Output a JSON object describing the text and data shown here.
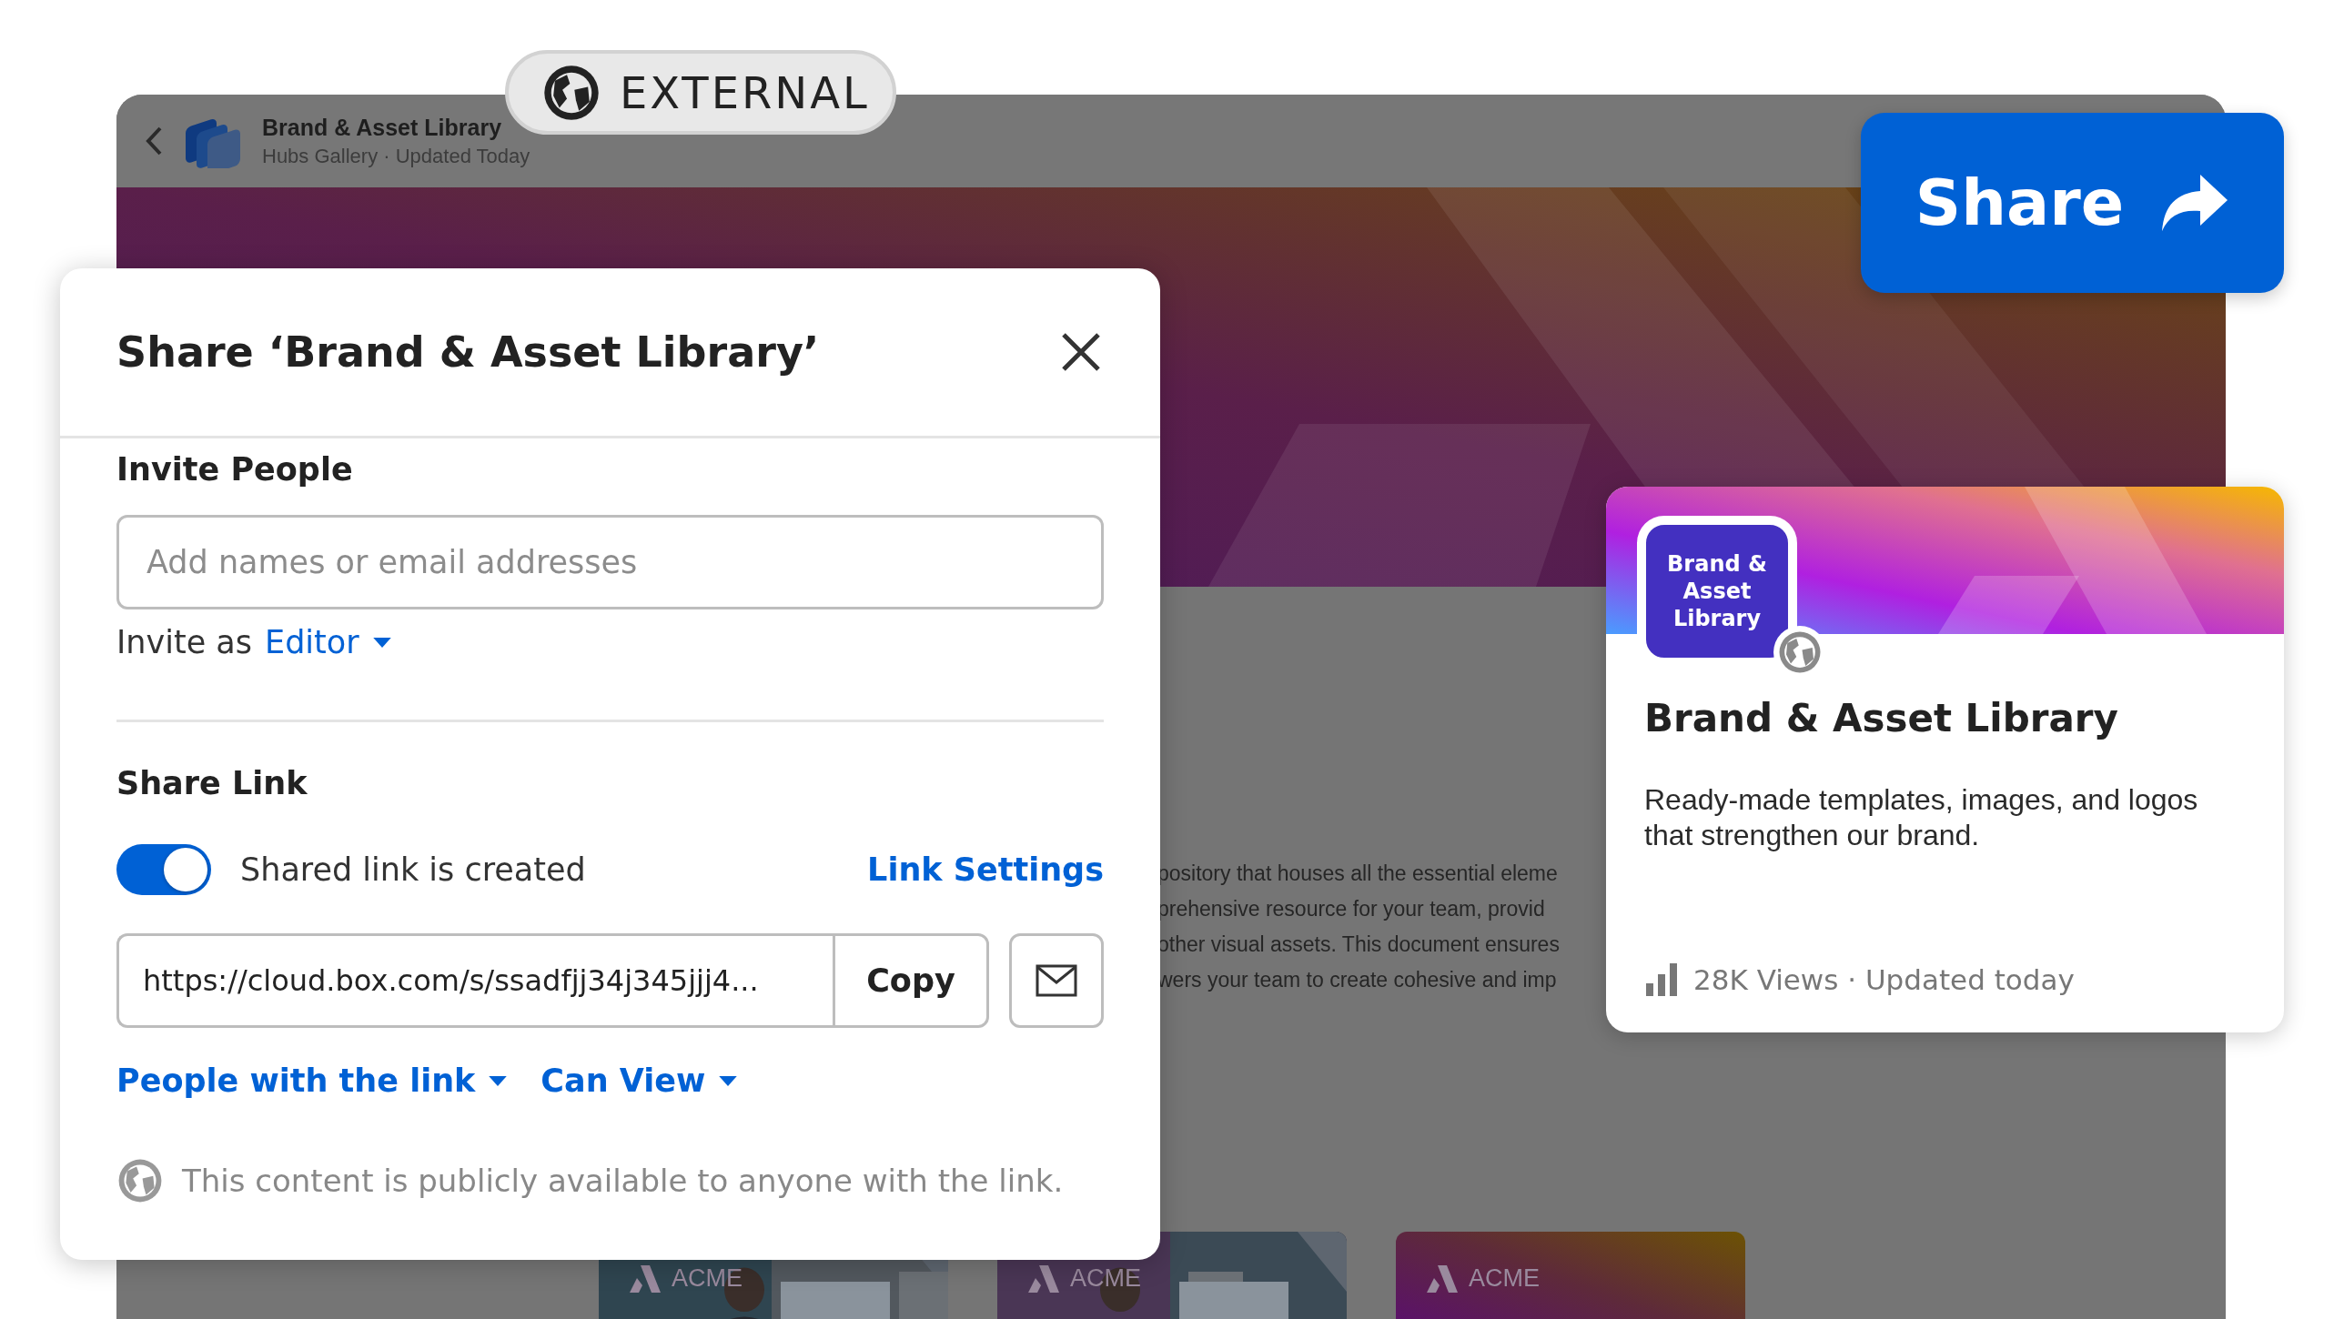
{
  "background_page": {
    "title": "Brand & Asset Library",
    "subtitle": "Hubs Gallery · Updated Today",
    "description_lines": [
      "pository that houses all the essential eleme",
      "prehensive resource for your team, provid",
      "other visual assets. This document ensures",
      "wers your team to create cohesive and imp"
    ],
    "thumbnails": [
      {
        "label": "ACME",
        "kind": "picture"
      },
      {
        "label": "ACME",
        "kind": "picture"
      },
      {
        "label": "ACME",
        "kind": "gradient"
      }
    ]
  },
  "external_badge": {
    "label": "EXTERNAL"
  },
  "share_button": {
    "label": "Share"
  },
  "share_dialog": {
    "title": "Share ‘Brand & Asset Library’",
    "invite_section": {
      "heading": "Invite People",
      "placeholder": "Add names or email addresses",
      "invite_as_label": "Invite as",
      "role": "Editor"
    },
    "link_section": {
      "heading": "Share Link",
      "toggle_label": "Shared link is created",
      "toggle_on": true,
      "settings_link": "Link Settings",
      "url": "https://cloud.box.com/s/ssadfjj34j345jjj4...",
      "copy_button": "Copy",
      "audience": "People with the link",
      "permission": "Can View",
      "notice": "This content is publicly available to anyone with the link."
    }
  },
  "hub_card": {
    "tile_text": "Brand & Asset Library",
    "title": "Brand & Asset Library",
    "description": "Ready-made templates, images, and logos that strengthen our brand.",
    "stats": "28K Views · Updated today"
  }
}
